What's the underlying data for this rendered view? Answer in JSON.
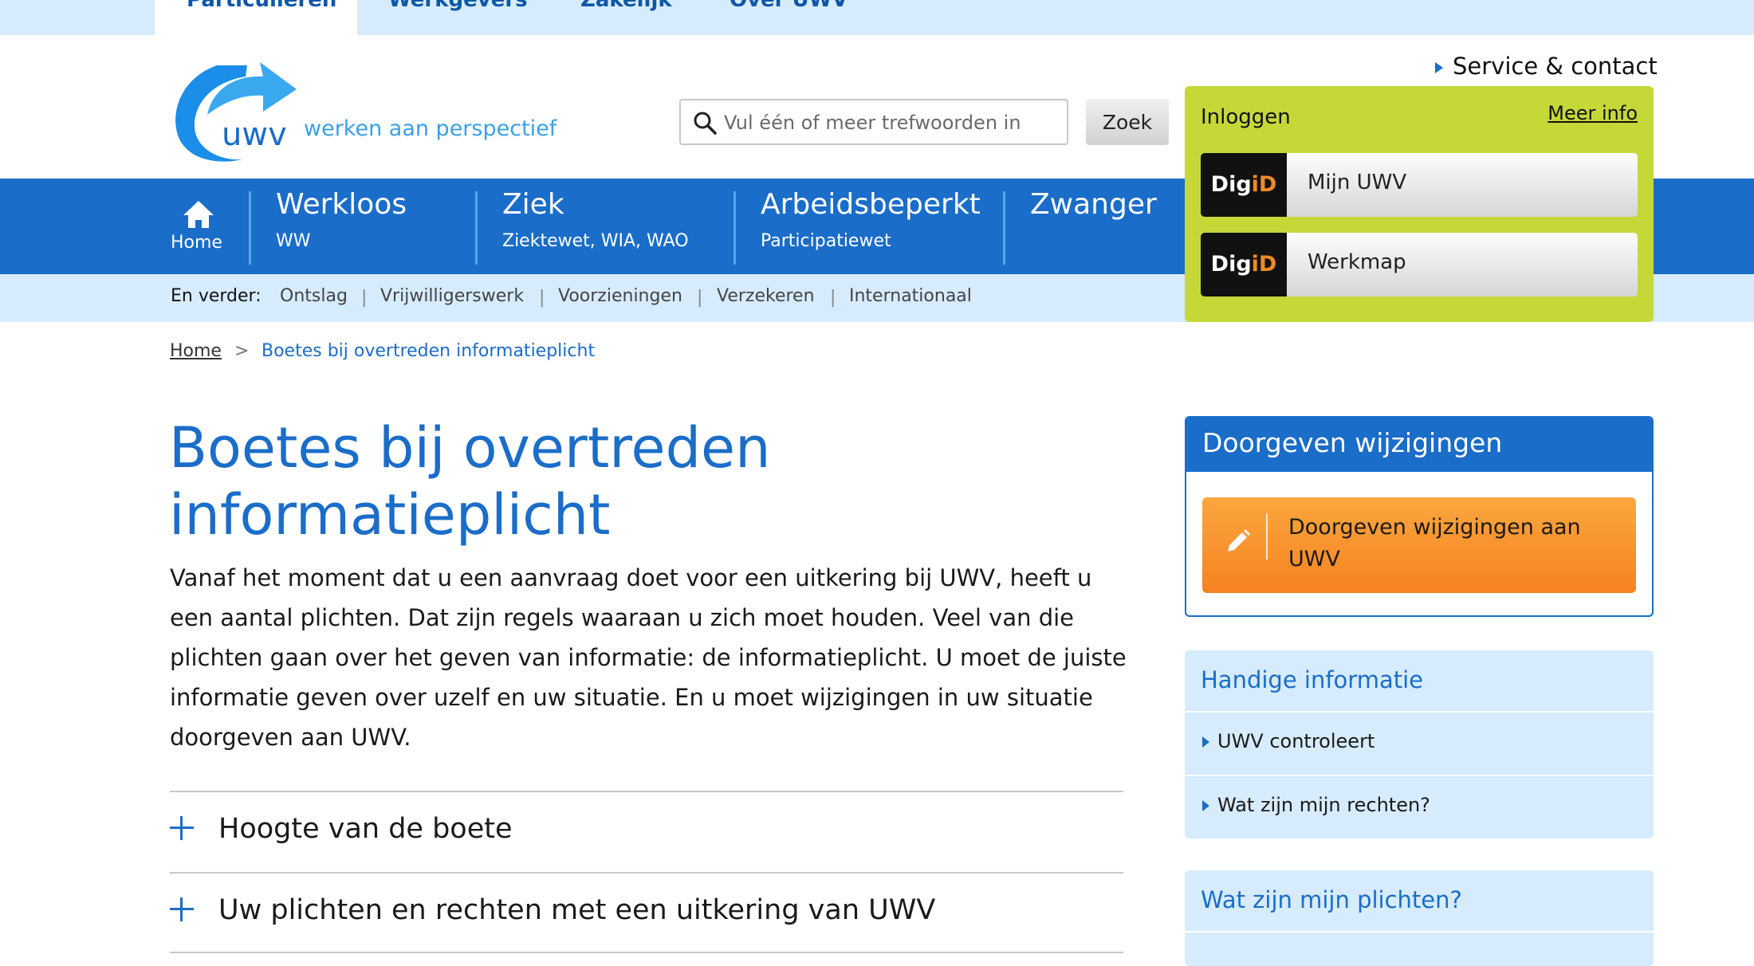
{
  "top_tabs": [
    "Particulieren",
    "Werkgevers",
    "Zakelijk",
    "Over UWV"
  ],
  "header": {
    "logo_text": "uwv",
    "tagline": "werken aan perspectief",
    "search_placeholder": "Vul één of meer trefwoorden in",
    "search_button": "Zoek",
    "service_link": "Service & contact"
  },
  "main_nav": {
    "home_label": "Home",
    "items": [
      {
        "title": "Werkloos",
        "sub": "WW"
      },
      {
        "title": "Ziek",
        "sub": "Ziektewet, WIA, WAO"
      },
      {
        "title": "Arbeidsbeperkt",
        "sub": "Participatiewet"
      },
      {
        "title": "Zwanger",
        "sub": ""
      }
    ]
  },
  "sub_nav": {
    "label": "En verder:",
    "items": [
      "Ontslag",
      "Vrijwilligerswerk",
      "Voorzieningen",
      "Verzekeren",
      "Internationaal"
    ]
  },
  "login": {
    "title": "Inloggen",
    "more_info": "Meer info",
    "digid_prefix": "Dig",
    "digid_i": "i",
    "digid_suffix": "D",
    "buttons": [
      "Mijn UWV",
      "Werkmap"
    ]
  },
  "breadcrumb": {
    "home": "Home",
    "separator": ">",
    "current": "Boetes bij overtreden informatieplicht"
  },
  "main": {
    "title": "Boetes bij overtreden informatieplicht",
    "intro": "Vanaf het moment dat u een aanvraag doet voor een uitkering bij UWV, heeft u een aantal plichten. Dat zijn regels waaraan u zich moet houden. Veel van die plichten gaan over het geven van informatie: de informatieplicht. U moet de juiste informatie geven over uzelf en uw situatie. En u moet wijzigingen in uw situatie doorgeven aan UWV.",
    "accordion": [
      "Hoogte van de boete",
      "Uw plichten en rechten met een uitkering van UWV"
    ]
  },
  "sidebar": {
    "doorgeven": {
      "title": "Doorgeven wijzigingen",
      "button": "Doorgeven wijzigingen aan UWV"
    },
    "handige": {
      "title": "Handige informatie",
      "links": [
        "UWV controleert",
        "Wat zijn mijn rechten?"
      ]
    },
    "plichten": {
      "title": "Wat zijn mijn plichten?"
    }
  },
  "colors": {
    "brand_blue": "#1a6dc9",
    "login_green": "#c6d838",
    "orange": "#f58220",
    "light_blue": "#d6ebfb"
  }
}
